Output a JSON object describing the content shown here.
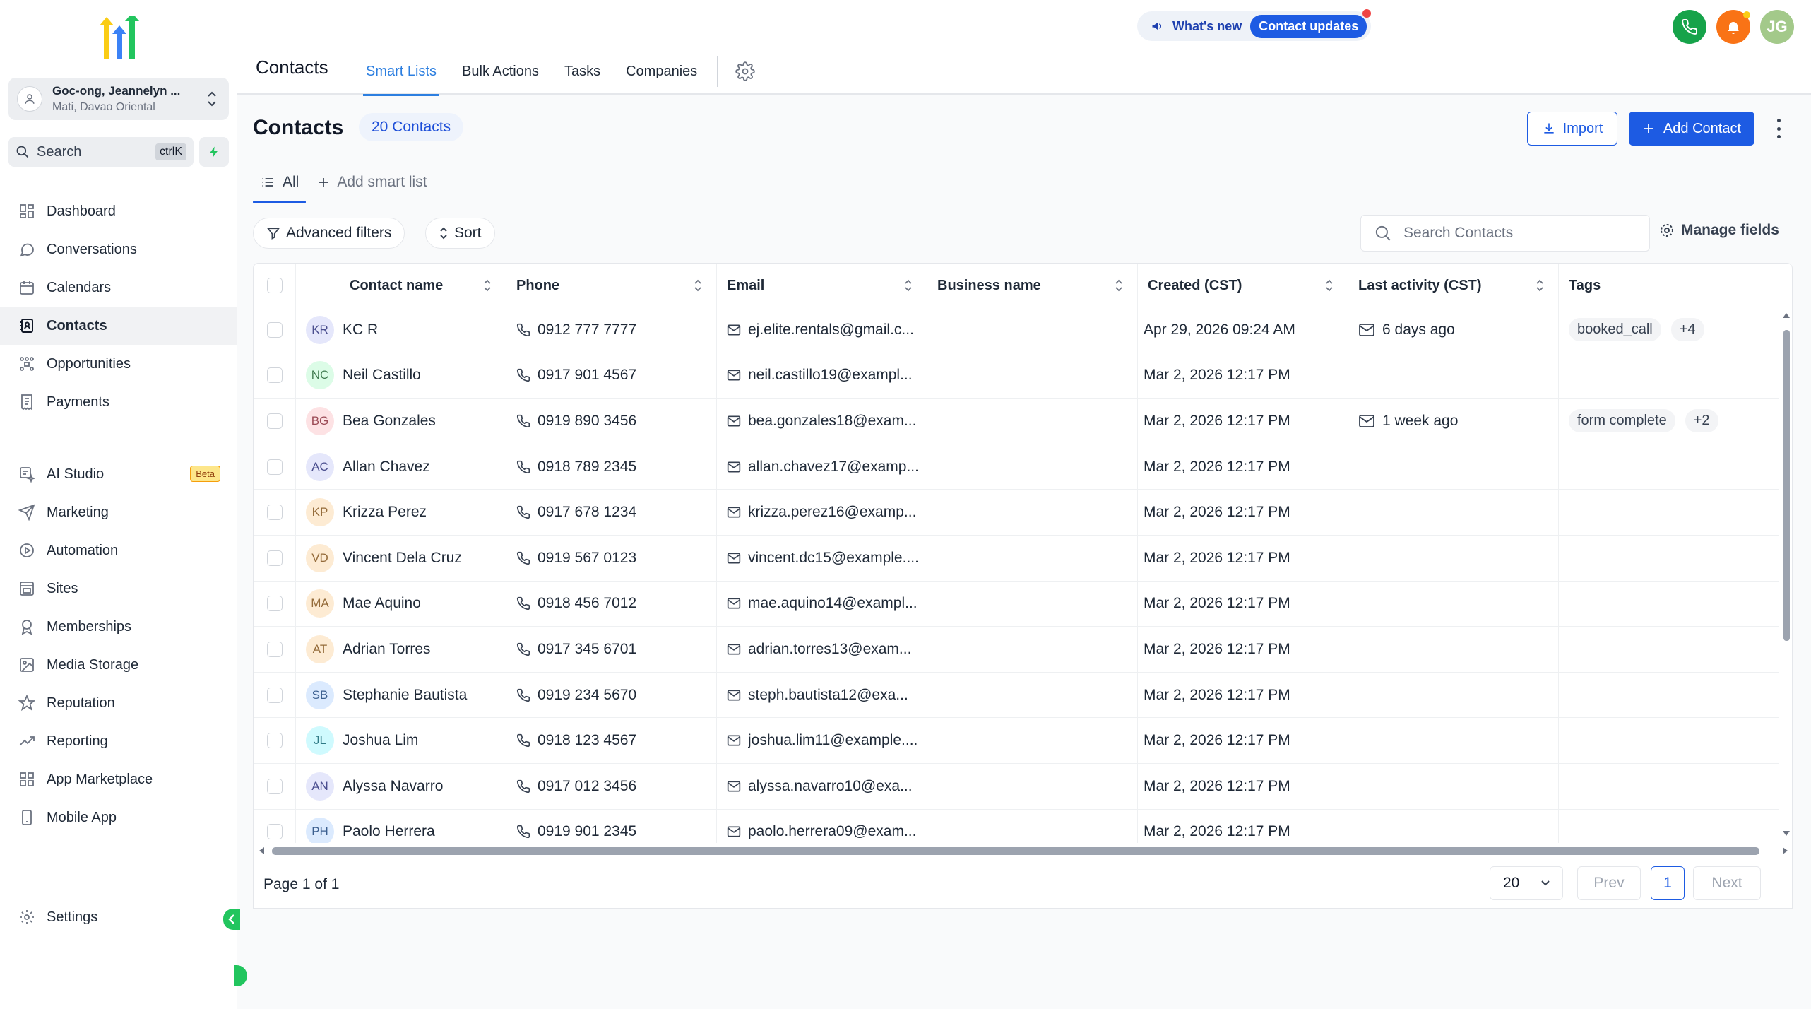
{
  "sidebar": {
    "location_name": "Goc-ong, Jeannelyn ...",
    "location_sub": "Mati, Davao Oriental",
    "search_label": "Search",
    "search_shortcut": "ctrlK",
    "items": [
      {
        "label": "Dashboard",
        "icon": "dashboard-icon"
      },
      {
        "label": "Conversations",
        "icon": "chat-icon"
      },
      {
        "label": "Calendars",
        "icon": "calendar-icon"
      },
      {
        "label": "Contacts",
        "icon": "contacts-icon"
      },
      {
        "label": "Opportunities",
        "icon": "opportunities-icon"
      },
      {
        "label": "Payments",
        "icon": "payments-icon"
      },
      {
        "label": "AI Studio",
        "icon": "ai-studio-icon"
      },
      {
        "label": "Marketing",
        "icon": "send-icon"
      },
      {
        "label": "Automation",
        "icon": "automation-icon"
      },
      {
        "label": "Sites",
        "icon": "sites-icon"
      },
      {
        "label": "Memberships",
        "icon": "award-icon"
      },
      {
        "label": "Media Storage",
        "icon": "image-icon"
      },
      {
        "label": "Reputation",
        "icon": "star-icon"
      },
      {
        "label": "Reporting",
        "icon": "trending-icon"
      },
      {
        "label": "App Marketplace",
        "icon": "grid-icon"
      },
      {
        "label": "Mobile App",
        "icon": "mobile-icon"
      }
    ],
    "beta_label": "Beta",
    "settings_label": "Settings"
  },
  "header": {
    "title": "Contacts",
    "tabs": [
      "Smart Lists",
      "Bulk Actions",
      "Tasks",
      "Companies"
    ],
    "whats_new": "What's new",
    "contact_updates": "Contact updates",
    "avatar_initials": "JG"
  },
  "main": {
    "title": "Contacts",
    "count_badge": "20 Contacts",
    "import_label": "Import",
    "add_label": "Add Contact",
    "subtabs": [
      "All",
      "Add smart list"
    ],
    "advanced_filters": "Advanced filters",
    "sort_label": "Sort",
    "search_placeholder": "Search Contacts",
    "manage_fields": "Manage fields"
  },
  "table": {
    "columns": [
      "Contact name",
      "Phone",
      "Email",
      "Business name",
      "Created (CST)",
      "Last activity (CST)",
      "Tags"
    ],
    "rows": [
      {
        "initials": "KR",
        "name": "KC R",
        "phone": "0912 777 7777",
        "email": "ej.elite.rentals@gmail.c...",
        "business": "",
        "created": "Apr 29, 2026 09:24 AM",
        "activity": "6 days ago",
        "tag": "booked_call",
        "tag_more": "+4",
        "av_bg": "#e5e7fb",
        "av_fg": "#4b4f8f"
      },
      {
        "initials": "NC",
        "name": "Neil Castillo",
        "phone": "0917 901 4567",
        "email": "neil.castillo19@exampl...",
        "business": "",
        "created": "Mar 2, 2026 12:17 PM",
        "activity": "",
        "tag": "",
        "tag_more": "",
        "av_bg": "#dcfce7",
        "av_fg": "#3f7a4f"
      },
      {
        "initials": "BG",
        "name": "Bea Gonzales",
        "phone": "0919 890 3456",
        "email": "bea.gonzales18@exam...",
        "business": "",
        "created": "Mar 2, 2026 12:17 PM",
        "activity": "1 week ago",
        "tag": "form complete",
        "tag_more": "+2",
        "av_bg": "#fde2e4",
        "av_fg": "#9b4a55"
      },
      {
        "initials": "AC",
        "name": "Allan Chavez",
        "phone": "0918 789 2345",
        "email": "allan.chavez17@examp...",
        "business": "",
        "created": "Mar 2, 2026 12:17 PM",
        "activity": "",
        "tag": "",
        "tag_more": "",
        "av_bg": "#e5e7fb",
        "av_fg": "#4b4f8f"
      },
      {
        "initials": "KP",
        "name": "Krizza Perez",
        "phone": "0917 678 1234",
        "email": "krizza.perez16@examp...",
        "business": "",
        "created": "Mar 2, 2026 12:17 PM",
        "activity": "",
        "tag": "",
        "tag_more": "",
        "av_bg": "#fdebd3",
        "av_fg": "#946b3a"
      },
      {
        "initials": "VD",
        "name": "Vincent Dela Cruz",
        "phone": "0919 567 0123",
        "email": "vincent.dc15@example....",
        "business": "",
        "created": "Mar 2, 2026 12:17 PM",
        "activity": "",
        "tag": "",
        "tag_more": "",
        "av_bg": "#fdebd3",
        "av_fg": "#946b3a"
      },
      {
        "initials": "MA",
        "name": "Mae Aquino",
        "phone": "0918 456 7012",
        "email": "mae.aquino14@exampl...",
        "business": "",
        "created": "Mar 2, 2026 12:17 PM",
        "activity": "",
        "tag": "",
        "tag_more": "",
        "av_bg": "#fdebd3",
        "av_fg": "#946b3a"
      },
      {
        "initials": "AT",
        "name": "Adrian Torres",
        "phone": "0917 345 6701",
        "email": "adrian.torres13@exam...",
        "business": "",
        "created": "Mar 2, 2026 12:17 PM",
        "activity": "",
        "tag": "",
        "tag_more": "",
        "av_bg": "#fdebd3",
        "av_fg": "#946b3a"
      },
      {
        "initials": "SB",
        "name": "Stephanie Bautista",
        "phone": "0919 234 5670",
        "email": "steph.bautista12@exa...",
        "business": "",
        "created": "Mar 2, 2026 12:17 PM",
        "activity": "",
        "tag": "",
        "tag_more": "",
        "av_bg": "#dbeafe",
        "av_fg": "#3b5f8f"
      },
      {
        "initials": "JL",
        "name": "Joshua Lim",
        "phone": "0918 123 4567",
        "email": "joshua.lim11@example....",
        "business": "",
        "created": "Mar 2, 2026 12:17 PM",
        "activity": "",
        "tag": "",
        "tag_more": "",
        "av_bg": "#cffafe",
        "av_fg": "#2f7a86"
      },
      {
        "initials": "AN",
        "name": "Alyssa Navarro",
        "phone": "0917 012 3456",
        "email": "alyssa.navarro10@exa...",
        "business": "",
        "created": "Mar 2, 2026 12:17 PM",
        "activity": "",
        "tag": "",
        "tag_more": "",
        "av_bg": "#e5e7fb",
        "av_fg": "#4b4f8f"
      },
      {
        "initials": "PH",
        "name": "Paolo Herrera",
        "phone": "0919 901 2345",
        "email": "paolo.herrera09@exam...",
        "business": "",
        "created": "Mar 2, 2026 12:17 PM",
        "activity": "",
        "tag": "",
        "tag_more": "",
        "av_bg": "#dbeafe",
        "av_fg": "#3b5f8f"
      }
    ]
  },
  "pager": {
    "info": "Page 1 of 1",
    "per_page": "20",
    "prev": "Prev",
    "current": "1",
    "next": "Next"
  },
  "colors": {
    "primary": "#1d5be3",
    "tab_active": "#2d7fe0",
    "phone_button": "#16a34a",
    "bell_button": "#f97316",
    "avatar": "#a3c98a"
  }
}
